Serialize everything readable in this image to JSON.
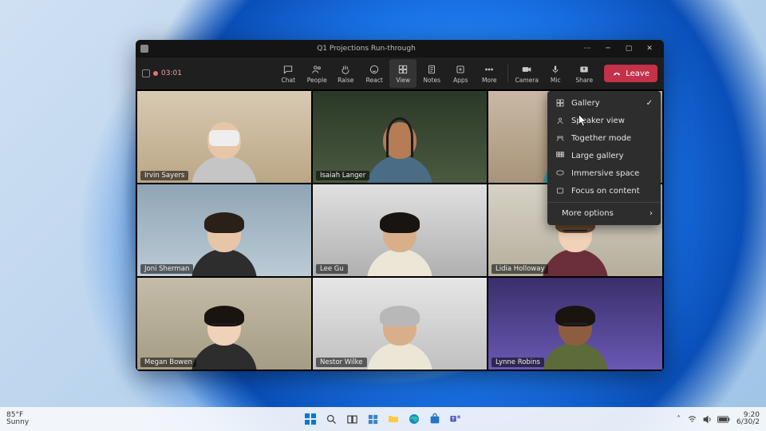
{
  "meeting": {
    "title": "Q1 Projections Run-through",
    "timer": "03:01",
    "leave_label": "Leave"
  },
  "toolbar": {
    "chat": "Chat",
    "people": "People",
    "raise": "Raise",
    "react": "React",
    "view": "View",
    "notes": "Notes",
    "apps": "Apps",
    "more": "More",
    "camera": "Camera",
    "mic": "Mic",
    "share": "Share"
  },
  "view_menu": {
    "items": [
      {
        "label": "Gallery",
        "checked": true
      },
      {
        "label": "Speaker view",
        "checked": false
      },
      {
        "label": "Together mode",
        "checked": false
      },
      {
        "label": "Large gallery",
        "checked": false
      },
      {
        "label": "Immersive space",
        "checked": false
      },
      {
        "label": "Focus on content",
        "checked": false
      }
    ],
    "more_label": "More options"
  },
  "participants": [
    {
      "name": "Irvin Sayers"
    },
    {
      "name": "Isaiah Langer"
    },
    {
      "name": ""
    },
    {
      "name": "Joni Sherman"
    },
    {
      "name": "Lee Gu"
    },
    {
      "name": "Lidia Holloway"
    },
    {
      "name": "Megan Bowen"
    },
    {
      "name": "Nestor Wilke"
    },
    {
      "name": "Lynne Robins"
    }
  ],
  "taskbar": {
    "weather_temp": "85°F",
    "weather_cond": "Sunny",
    "time": "9:20",
    "date": "6/30/2"
  }
}
